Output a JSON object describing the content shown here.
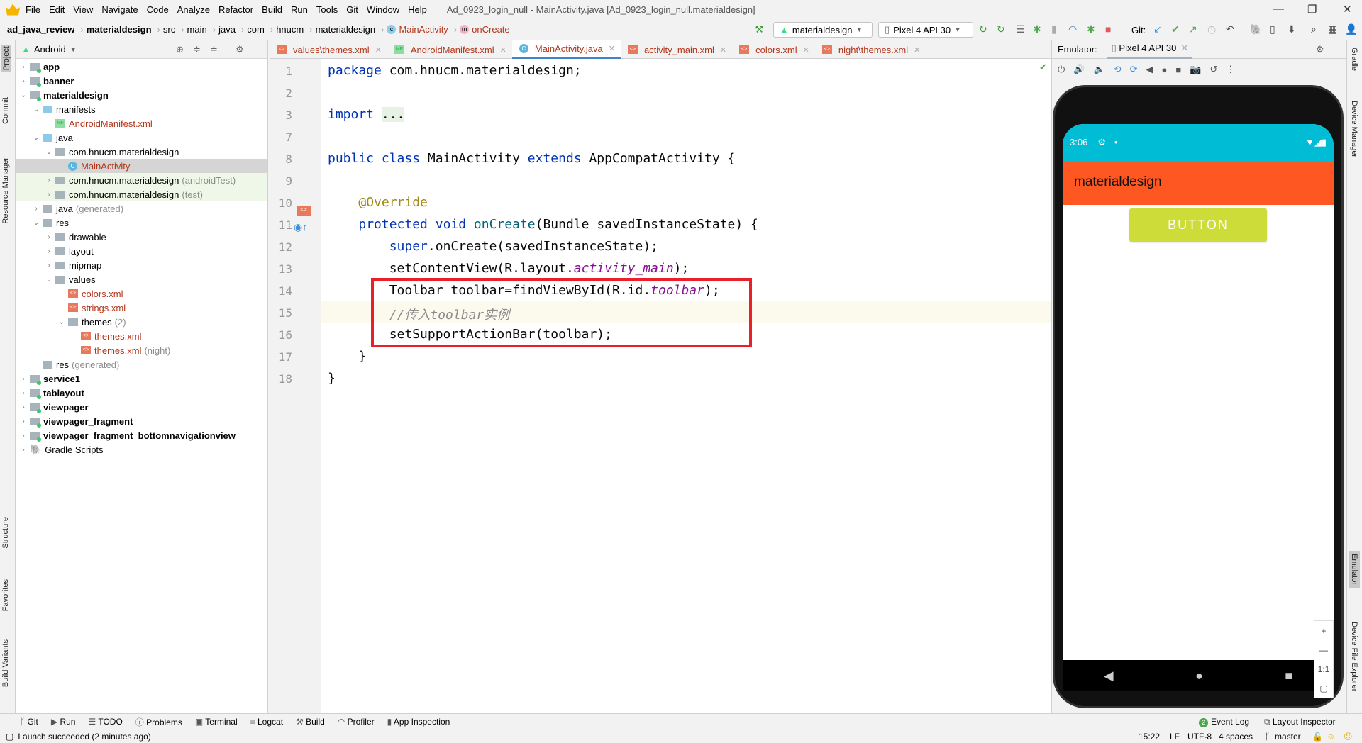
{
  "window": {
    "title": "Ad_0923_login_null - MainActivity.java [Ad_0923_login_null.materialdesign]",
    "menu": [
      "File",
      "Edit",
      "View",
      "Navigate",
      "Code",
      "Analyze",
      "Refactor",
      "Build",
      "Run",
      "Tools",
      "Git",
      "Window",
      "Help"
    ]
  },
  "breadcrumb": [
    "ad_java_review",
    "materialdesign",
    "src",
    "main",
    "java",
    "com",
    "hnucm",
    "materialdesign",
    "MainActivity",
    "onCreate"
  ],
  "toolbar": {
    "run_config": "materialdesign",
    "device": "Pixel 4 API 30",
    "git_label": "Git:"
  },
  "left_strip": [
    "Project",
    "Commit",
    "Resource Manager",
    "Structure",
    "Favorites",
    "Build Variants"
  ],
  "right_strip": [
    "Gradle",
    "Device Manager",
    "Emulator",
    "Device File Explorer"
  ],
  "project": {
    "view": "Android",
    "tree": [
      {
        "label": "app",
        "depth": 0,
        "kind": "module",
        "arrow": "›"
      },
      {
        "label": "banner",
        "depth": 0,
        "kind": "module",
        "arrow": "›"
      },
      {
        "label": "materialdesign",
        "depth": 0,
        "kind": "module",
        "arrow": "⌄"
      },
      {
        "label": "manifests",
        "depth": 1,
        "kind": "folder-blue",
        "arrow": "⌄"
      },
      {
        "label": "AndroidManifest.xml",
        "depth": 2,
        "kind": "manifest",
        "arrow": ""
      },
      {
        "label": "java",
        "depth": 1,
        "kind": "folder-blue",
        "arrow": "⌄"
      },
      {
        "label": "com.hnucm.materialdesign",
        "depth": 2,
        "kind": "package",
        "arrow": "⌄"
      },
      {
        "label": "MainActivity",
        "depth": 3,
        "kind": "class",
        "arrow": "",
        "selected": true
      },
      {
        "label": "com.hnucm.materialdesign",
        "suffix": "(androidTest)",
        "depth": 2,
        "kind": "package",
        "arrow": "›",
        "test": true
      },
      {
        "label": "com.hnucm.materialdesign",
        "suffix": "(test)",
        "depth": 2,
        "kind": "package",
        "arrow": "›",
        "test": true
      },
      {
        "label": "java",
        "suffix": "(generated)",
        "depth": 1,
        "kind": "folder",
        "arrow": "›"
      },
      {
        "label": "res",
        "depth": 1,
        "kind": "folder",
        "arrow": "⌄"
      },
      {
        "label": "drawable",
        "depth": 2,
        "kind": "package",
        "arrow": "›"
      },
      {
        "label": "layout",
        "depth": 2,
        "kind": "package",
        "arrow": "›"
      },
      {
        "label": "mipmap",
        "depth": 2,
        "kind": "package",
        "arrow": "›"
      },
      {
        "label": "values",
        "depth": 2,
        "kind": "package",
        "arrow": "⌄"
      },
      {
        "label": "colors.xml",
        "depth": 3,
        "kind": "xml",
        "arrow": ""
      },
      {
        "label": "strings.xml",
        "depth": 3,
        "kind": "xml",
        "arrow": ""
      },
      {
        "label": "themes",
        "suffix": "(2)",
        "depth": 3,
        "kind": "package",
        "arrow": "⌄"
      },
      {
        "label": "themes.xml",
        "depth": 4,
        "kind": "xml",
        "arrow": ""
      },
      {
        "label": "themes.xml",
        "suffix": "(night)",
        "depth": 4,
        "kind": "xml",
        "arrow": ""
      },
      {
        "label": "res",
        "suffix": "(generated)",
        "depth": 1,
        "kind": "folder",
        "arrow": ""
      },
      {
        "label": "service1",
        "depth": 0,
        "kind": "module",
        "arrow": "›"
      },
      {
        "label": "tablayout",
        "depth": 0,
        "kind": "module",
        "arrow": "›"
      },
      {
        "label": "viewpager",
        "depth": 0,
        "kind": "module",
        "arrow": "›"
      },
      {
        "label": "viewpager_fragment",
        "depth": 0,
        "kind": "module",
        "arrow": "›"
      },
      {
        "label": "viewpager_fragment_bottomnavigationview",
        "depth": 0,
        "kind": "module",
        "arrow": "›"
      },
      {
        "label": "Gradle Scripts",
        "depth": 0,
        "kind": "gradle",
        "arrow": "›"
      }
    ]
  },
  "tabs": [
    {
      "label": "values\\themes.xml",
      "icon": "xml"
    },
    {
      "label": "AndroidManifest.xml",
      "icon": "manifest"
    },
    {
      "label": "MainActivity.java",
      "icon": "class",
      "active": true
    },
    {
      "label": "activity_main.xml",
      "icon": "xml"
    },
    {
      "label": "colors.xml",
      "icon": "xml"
    },
    {
      "label": "night\\themes.xml",
      "icon": "xml"
    }
  ],
  "code": [
    {
      "n": "1",
      "html": "<span class='kw'>package</span> com.hnucm.materialdesign;"
    },
    {
      "n": "2",
      "html": ""
    },
    {
      "n": "3",
      "html": "<span class='kw'>import</span> <span style='background:#e8f2e4'>...</span>"
    },
    {
      "n": "7",
      "html": ""
    },
    {
      "n": "8",
      "html": "<span class='kw'>public class</span> MainActivity <span class='kw'>extends</span> AppCompatActivity {"
    },
    {
      "n": "9",
      "html": ""
    },
    {
      "n": "10",
      "html": "    <span class='an'>@Override</span>"
    },
    {
      "n": "11",
      "html": "    <span class='kw'>protected void</span> <span class='fn'>onCreate</span>(Bundle savedInstanceState) {"
    },
    {
      "n": "12",
      "html": "        <span class='kw'>super</span>.onCreate(savedInstanceState);"
    },
    {
      "n": "13",
      "html": "        setContentView(R.layout.<span class='it'>activity_main</span>);"
    },
    {
      "n": "14",
      "html": "        Toolbar toolbar=findViewById(R.id.<span class='it'>toolbar</span>);"
    },
    {
      "n": "15",
      "html": "        <span class='cm'>//传入toolbar实例</span>"
    },
    {
      "n": "16",
      "html": "        setSupportActionBar(toolbar);"
    },
    {
      "n": "17",
      "html": "    }"
    },
    {
      "n": "18",
      "html": "}"
    }
  ],
  "emulator": {
    "label": "Emulator:",
    "device_tab": "Pixel 4 API 30",
    "status_time": "3:06",
    "app_title": "materialdesign",
    "button_label": "BUTTON",
    "zoom_ratio": "1:1",
    "colors": {
      "status": "#00bcd4",
      "toolbar": "#ff5722",
      "button": "#cddc39"
    }
  },
  "bottom_tools": [
    "Git",
    "Run",
    "TODO",
    "Problems",
    "Terminal",
    "Logcat",
    "Build",
    "Profiler",
    "App Inspection"
  ],
  "bottom_right": [
    "Event Log",
    "Layout Inspector"
  ],
  "event_count": "2",
  "status": {
    "message": "Launch succeeded (2 minutes ago)",
    "position": "15:22",
    "line_sep": "LF",
    "encoding": "UTF-8",
    "indent": "4 spaces",
    "branch": "master"
  }
}
